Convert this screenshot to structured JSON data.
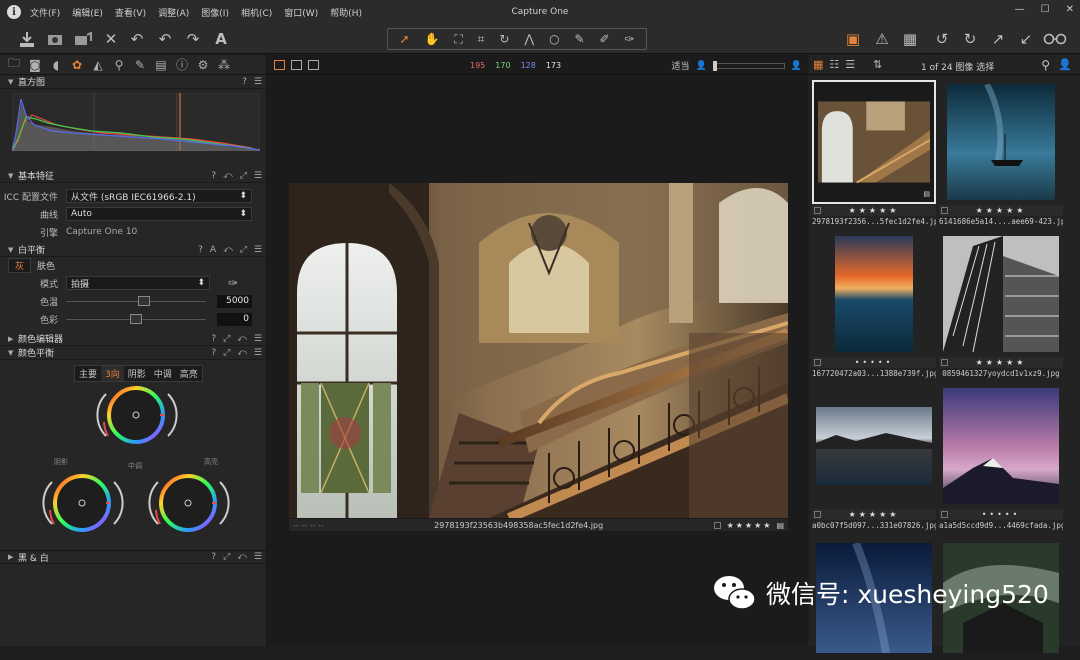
{
  "app": {
    "title": "Capture One"
  },
  "menu": [
    "文件(F)",
    "编辑(E)",
    "查看(V)",
    "调整(A)",
    "图像(I)",
    "相机(C)",
    "窗口(W)",
    "帮助(H)"
  ],
  "window_buttons": [
    "—",
    "☐",
    "✕"
  ],
  "toolbar": {
    "left_icons": [
      "import-icon",
      "camera-icon",
      "capture-icon",
      "close-icon",
      "undo-all-icon",
      "undo-icon",
      "redo-icon",
      "text-icon"
    ],
    "cursor_tools": [
      "pointer-icon",
      "hand-icon",
      "loupe-icon",
      "crop-icon",
      "rotate-icon",
      "keystone-icon",
      "spot-icon",
      "brush-icon",
      "eraser-icon",
      "picker-icon"
    ],
    "right_icons": [
      "layers-icon",
      "warning-icon",
      "grid-icon",
      "rotate-left-icon",
      "rotate-right-icon",
      "expand-icon",
      "collapse-icon",
      "glasses-icon"
    ]
  },
  "tool_tabs": [
    "folder-icon",
    "camera-icon",
    "lens-icon",
    "color-icon",
    "exposure-icon",
    "search-icon",
    "brush-icon",
    "details-icon",
    "info-icon",
    "gear-icon",
    "style-icon"
  ],
  "histogram": {
    "title": "直方图",
    "help": "?",
    "menu": "☰",
    "left_label": "--",
    "mid_label": "--",
    "right_label": "--"
  },
  "basic": {
    "title": "基本特征",
    "icc_label": "ICC 配置文件",
    "icc_value": "从文件 (sRGB IEC61966-2.1)",
    "curve_label": "曲线",
    "curve_value": "Auto",
    "engine_label": "引擎",
    "engine_value": "Capture One 10"
  },
  "wb": {
    "title": "白平衡",
    "tabs": [
      "灰",
      "肤色"
    ],
    "mode_label": "模式",
    "mode_value": "拍摄",
    "temp_label": "色温",
    "temp_value": "5000",
    "tint_label": "色彩",
    "tint_value": "0"
  },
  "color_editor": {
    "title": "颜色编辑器"
  },
  "color_balance": {
    "title": "颜色平衡",
    "tabs": [
      "主要",
      "3向",
      "阴影",
      "中调",
      "高亮"
    ],
    "active_tab": "3向",
    "wheel_labels": [
      "阴影",
      "中调",
      "高亮"
    ]
  },
  "bw": {
    "title": "黑 & 白"
  },
  "viewer": {
    "rgb": [
      {
        "v": "195",
        "c": "#e86a6a"
      },
      {
        "v": "170",
        "c": "#7ad67a"
      },
      {
        "v": "128",
        "c": "#7a8ae8"
      },
      {
        "v": "173",
        "c": "#e0e0e0"
      }
    ],
    "zoom_label": "适当",
    "caption": "2978193f23563b498358ac5fec1d2fe4.jpg",
    "caption_left": "-- -- -- --",
    "stars": "★★★★★"
  },
  "browser": {
    "count": "1 of 24 图像 选择",
    "items": [
      {
        "name": "2978193f2356...5fec1d2fe4.jpg",
        "stars": "★★★★★",
        "selected": true
      },
      {
        "name": "6141686e5a14....aee69-423.jpg",
        "stars": "★★★★★"
      },
      {
        "name": "167720472a03...1388e739f.jpg",
        "stars": "•••••"
      },
      {
        "name": "0859461327yoydcd1v1xz9.jpg",
        "stars": "★★★★★"
      },
      {
        "name": "a0bc07f5d097...331e07826.jpg",
        "stars": "★★★★★"
      },
      {
        "name": "a1a5d5ccd9d9...4469cfada.jpg",
        "stars": "•••••"
      },
      {
        "name": "",
        "stars": ""
      },
      {
        "name": "",
        "stars": ""
      }
    ]
  },
  "watermark": {
    "text": "微信号: xuesheying520"
  }
}
